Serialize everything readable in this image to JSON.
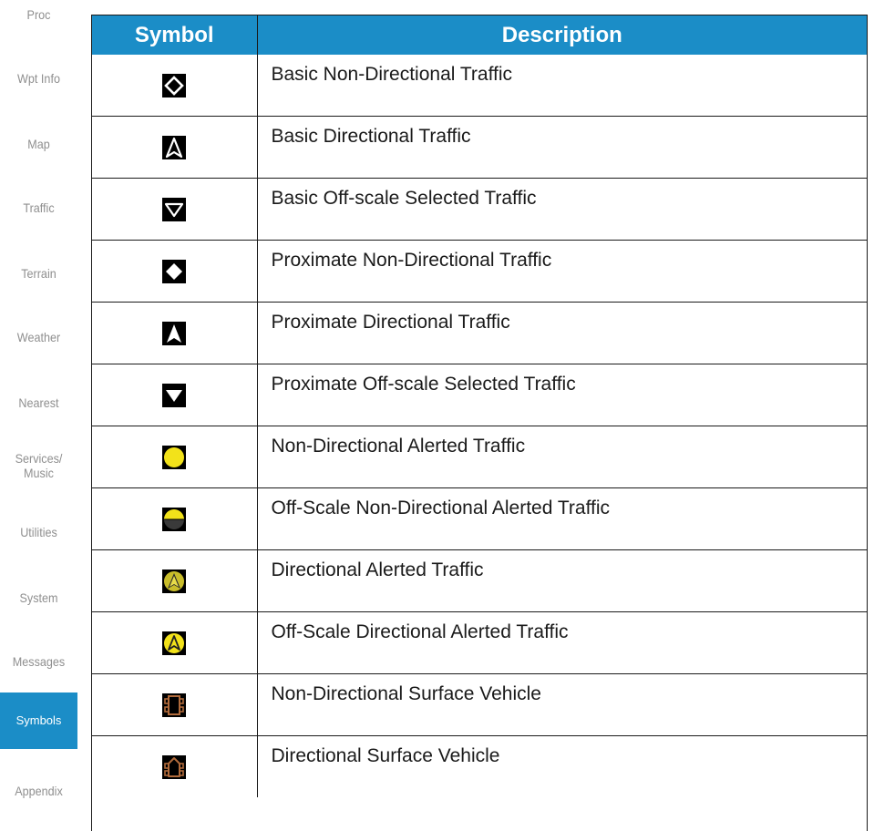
{
  "sidebar": {
    "items": [
      {
        "label": "Proc"
      },
      {
        "label": "Wpt Info"
      },
      {
        "label": "Map"
      },
      {
        "label": "Traffic"
      },
      {
        "label": "Terrain"
      },
      {
        "label": "Weather"
      },
      {
        "label": "Nearest"
      },
      {
        "label": "Services/\nMusic"
      },
      {
        "label": "Utilities"
      },
      {
        "label": "System"
      },
      {
        "label": "Messages"
      },
      {
        "label": "Symbols",
        "active": true
      },
      {
        "label": "Appendix"
      }
    ]
  },
  "table": {
    "headers": {
      "symbol": "Symbol",
      "description": "Description"
    },
    "rows": [
      {
        "icon": "basic-non-directional-traffic-icon",
        "description": "Basic Non-Directional Traffic"
      },
      {
        "icon": "basic-directional-traffic-icon",
        "description": "Basic Directional Traffic"
      },
      {
        "icon": "basic-off-scale-selected-traffic-icon",
        "description": "Basic Off-scale Selected Traffic"
      },
      {
        "icon": "proximate-non-directional-traffic-icon",
        "description": "Proximate Non-Directional Traffic"
      },
      {
        "icon": "proximate-directional-traffic-icon",
        "description": "Proximate Directional Traffic"
      },
      {
        "icon": "proximate-off-scale-selected-traffic-icon",
        "description": "Proximate Off-scale Selected Traffic"
      },
      {
        "icon": "non-directional-alerted-traffic-icon",
        "description": "Non-Directional Alerted Traffic"
      },
      {
        "icon": "off-scale-non-directional-alerted-traffic-icon",
        "description": "Off-Scale Non-Directional Alerted Traffic"
      },
      {
        "icon": "directional-alerted-traffic-icon",
        "description": "Directional Alerted Traffic"
      },
      {
        "icon": "off-scale-directional-alerted-traffic-icon",
        "description": "Off-Scale Directional Alerted Traffic"
      },
      {
        "icon": "non-directional-surface-vehicle-icon",
        "description": "Non-Directional Surface Vehicle"
      },
      {
        "icon": "directional-surface-vehicle-icon",
        "description": "Directional Surface Vehicle"
      }
    ]
  },
  "colors": {
    "accent": "#1b8dc7",
    "tab_text": "#8f8f8f",
    "alert_yellow": "#f2e21a",
    "vehicle_brown": "#b06a3b"
  }
}
